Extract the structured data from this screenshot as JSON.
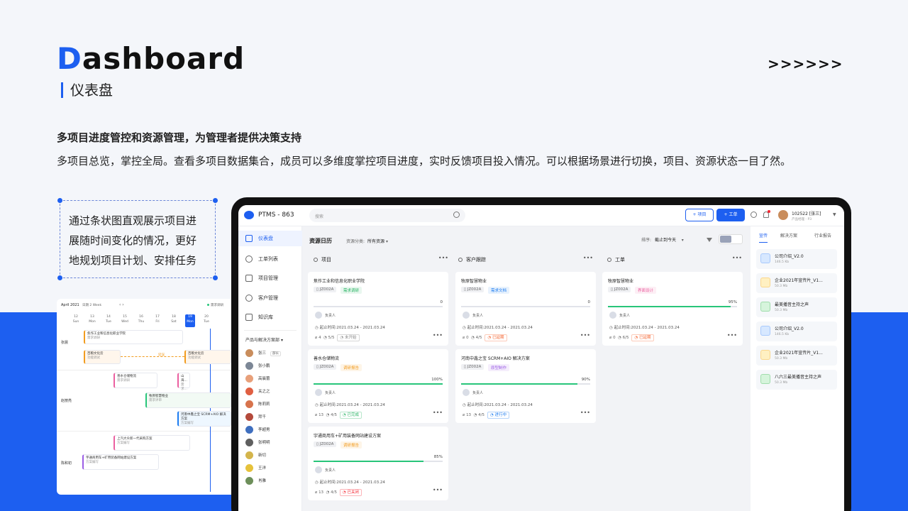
{
  "hero": {
    "title_initial": "D",
    "title_rest": "ashboard",
    "subtitle": "仪表盘",
    "arrows": ">>>>>>",
    "headline": "多项目进度管控和资源管理，为管理者提供决策支持",
    "description": "多项目总览，掌控全局。查看多项目数据集合，成员可以多维度掌控项目进度，实时反馈项目投入情况。可以根据场景进行切换，项目、资源状态一目了然。",
    "callout": "通过条状图直观展示项目进展随时间变化的情况，更好地规划项目计划、安排任务"
  },
  "gantt": {
    "month": "April 2021",
    "range": "日期 2 Week",
    "legend": "需求调研",
    "days": [
      {
        "num": "12",
        "wd": "Sun"
      },
      {
        "num": "13",
        "wd": "Mon"
      },
      {
        "num": "14",
        "wd": "Tue"
      },
      {
        "num": "15",
        "wd": "Wed"
      },
      {
        "num": "16",
        "wd": "Thu"
      },
      {
        "num": "17",
        "wd": "Fri"
      },
      {
        "num": "18",
        "wd": "Sat"
      },
      {
        "num": "19",
        "wd": "Mon"
      },
      {
        "num": "20",
        "wd": "Tue"
      }
    ],
    "people": [
      "张晨",
      "赵丽亮",
      "陈和初"
    ],
    "bars": [
      {
        "title": "焦作工业和信息化职业学院",
        "sub": "需求调研"
      },
      {
        "title": "百粮文化云",
        "sub": "功能调试"
      },
      {
        "title": "百粮文化云",
        "sub": "功能调试"
      },
      {
        "title": "善水仓储物流",
        "sub": "需求调研"
      },
      {
        "title": "山海...",
        "sub": "需求..."
      },
      {
        "title": "牧原智慧物业",
        "sub": "需求评审"
      },
      {
        "title": "河南中鑫之宝 SCRM+AIO 解决方案",
        "sub": "方案编写"
      },
      {
        "title": "上汽大众新一代采购方案",
        "sub": "方案编写"
      },
      {
        "title": "宇通商用车+矿用装备网站建设方案",
        "sub": "方案编写"
      }
    ],
    "link_label": "延误"
  },
  "app": {
    "brand": "PTMS - 863",
    "search_placeholder": "搜索",
    "btn_project": "+ 项目",
    "btn_order": "+ 工单",
    "user_name": "102522 [张三]",
    "user_role": "产品经理 - P3",
    "nav": [
      {
        "label": "仪表盘",
        "icon": "dashboard-icon"
      },
      {
        "label": "工单列表",
        "icon": "checklist-icon"
      },
      {
        "label": "项目管理",
        "icon": "calendar-icon"
      },
      {
        "label": "客户管理",
        "icon": "customers-icon"
      },
      {
        "label": "知识库",
        "icon": "book-icon"
      }
    ],
    "group_label": "产品与解决方案部",
    "members": [
      {
        "name": "张三",
        "badge": "部长",
        "color": "#c98d5c"
      },
      {
        "name": "张小鹏",
        "color": "#7c8796"
      },
      {
        "name": "高晨蕾",
        "color": "#e8a07a"
      },
      {
        "name": "关之之",
        "color": "#e05f42"
      },
      {
        "name": "陈莉莉",
        "color": "#d7734c"
      },
      {
        "name": "拜千",
        "color": "#b44a3b"
      },
      {
        "name": "李超男",
        "color": "#3f6fbf"
      },
      {
        "name": "张明明",
        "color": "#5f5f5f"
      },
      {
        "name": "新切",
        "color": "#d4b54c"
      },
      {
        "name": "王洋",
        "color": "#e6c23b"
      },
      {
        "name": "肖雅",
        "color": "#6d8f5a"
      }
    ],
    "main_title": "资源日历",
    "filter_label": "资源分类:",
    "filter_value": "所有资源",
    "sort_label": "排序:",
    "sort_value": "截止到今天",
    "columns": [
      {
        "label": "项目"
      },
      {
        "label": "客户跟踪"
      },
      {
        "label": "工单"
      }
    ],
    "cards": [
      {
        "name": "焦作工业和信息化职业学院",
        "code": "JZ002A",
        "tag": "需求调研",
        "tag_color": "#28b463",
        "progress": "0",
        "owner": "负责人",
        "deadline": "起止时间:2021.03.24 - 2021.03.24",
        "files": "4",
        "tasks": "5/5",
        "status": "未开始",
        "status_color": "#888888"
      },
      {
        "name": "善水仓储物流",
        "code": "JZ002A",
        "tag": "调研报告",
        "tag_color": "#f29c1f",
        "progress": "100%",
        "owner": "负责人",
        "deadline": "起止时间:2021.03.24 - 2021.03.24",
        "files": "13",
        "tasks": "4/5",
        "status": "已完成",
        "status_color": "#28b463"
      },
      {
        "name": "宇通商用车+矿用装备网站建设方案",
        "code": "JZ002A",
        "tag": "调研报告",
        "tag_color": "#f29c1f",
        "progress": "85%",
        "owner": "负责人",
        "deadline": "起止时间:2021.03.24 - 2021.03.24",
        "files": "13",
        "tasks": "4/5",
        "status": "已关闭",
        "status_color": "#f5222d"
      },
      {
        "name": "牧原智慧物业",
        "code": "JZ002A",
        "tag": "需求文档",
        "tag_color": "#1d7cf0",
        "progress": "0",
        "owner": "负责人",
        "deadline": "起止时间:2021.03.24 - 2021.03.24",
        "files": "0",
        "tasks": "4/5",
        "status": "已延期",
        "status_color": "#f5622d"
      },
      {
        "name": "河南中鑫之宝 SCRM+AIO 解决方案",
        "code": "JZ002A",
        "tag": "原型制作",
        "tag_color": "#9b5de5",
        "progress": "90%",
        "owner": "负责人",
        "deadline": "起止时间:2021.03.24 - 2021.03.24",
        "files": "13",
        "tasks": "4/5",
        "status": "进行中",
        "status_color": "#1d7cf0"
      },
      {
        "name": "牧原智慧物业",
        "code": "JZ002A",
        "tag": "界面设计",
        "tag_color": "#eb5fa0",
        "progress": "95%",
        "owner": "负责人",
        "deadline": "起止时间:2021.03.24 - 2021.03.24",
        "files": "0",
        "tasks": "6/5",
        "status": "已延期",
        "status_color": "#f5622d"
      }
    ],
    "right_tabs": [
      "宣传",
      "解决方案",
      "行业报告"
    ],
    "files": [
      {
        "name": "公司介绍_V2.0",
        "size": "146.5 Kb",
        "color": "#d7e8ff"
      },
      {
        "name": "企业2021年宣传片_V1...",
        "size": "50.3 Mb",
        "color": "#fff0c2"
      },
      {
        "name": "最美播音主持之声",
        "size": "50.3 Mb",
        "color": "#d6f4dc"
      },
      {
        "name": "公司介绍_V2.0",
        "size": "146.5 Kb",
        "color": "#d7e8ff"
      },
      {
        "name": "企业2021年宣传片_V1...",
        "size": "50.3 Mb",
        "color": "#fff0c2"
      },
      {
        "name": "八六三最美播音主持之声",
        "size": "50.3 Mb",
        "color": "#d6f4dc"
      }
    ]
  }
}
